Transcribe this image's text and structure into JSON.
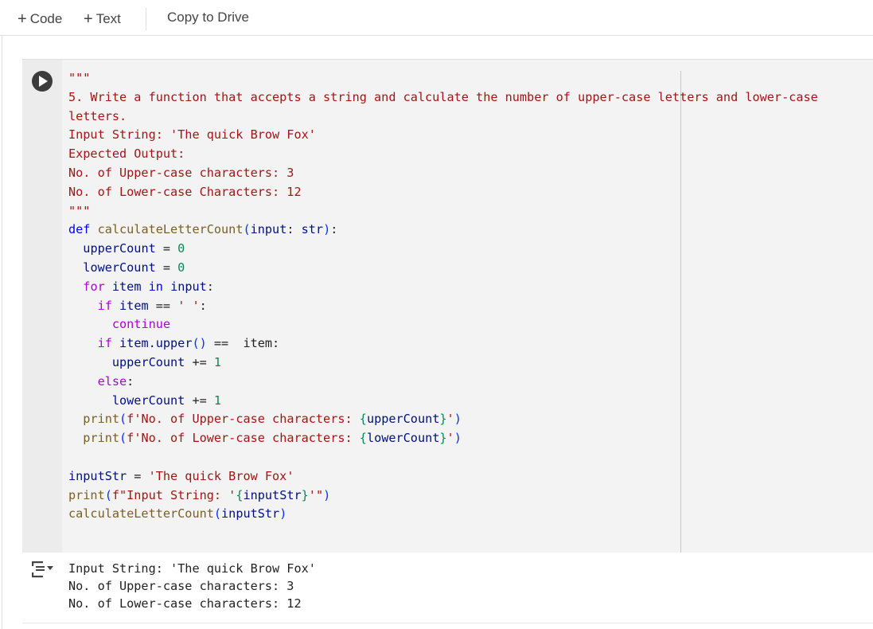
{
  "toolbar": {
    "code_label": "Code",
    "text_label": "Text",
    "copy_to_drive_label": "Copy to Drive"
  },
  "cell": {
    "docstring": [
      "\"\"\"",
      "5. Write a function that accepts a string and calculate the number of upper-case letters and lower-case",
      "letters.",
      "Input String: 'The quick Brow Fox'",
      "Expected Output:",
      "No. of Upper-case characters: 3",
      "No. of Lower-case Characters: 12",
      "\"\"\""
    ],
    "code": {
      "def_kw": "def",
      "fn_name": "calculateLetterCount",
      "lp": "(",
      "param": "input",
      "colon_type": ": ",
      "type": "str",
      "rp": ")",
      "def_end": ":",
      "upper_var": "upperCount",
      "assign": " = ",
      "zero": "0",
      "lower_var": "lowerCount",
      "for_kw": "for",
      "item": "item",
      "in_kw": "in",
      "input": "input",
      "colon": ":",
      "if_kw": "if",
      "eq": " == ",
      "space_str": "' '",
      "continue_kw": "continue",
      "item_upper": "item.upper",
      "call_parens": "()",
      "item_end": " item:",
      "plus_eq": " += ",
      "one": "1",
      "else_kw": "else",
      "print": "print",
      "fstr_upper_a": "f'No. of Upper-case characters: ",
      "lb": "{",
      "rb": "}",
      "fstr_end": "'",
      "fstr_lower_a": "f'No. of Lower-case characters: ",
      "input_var": "inputStr",
      "input_val": "'The quick Brow Fox'",
      "fstr_input_a": "f\"Input String: '",
      "fstr_input_end": "'\"",
      "call_name": "calculateLetterCount"
    }
  },
  "output": {
    "lines": [
      "Input String: 'The quick Brow Fox'",
      "No. of Upper-case characters: 3",
      "No. of Lower-case characters: 12"
    ]
  }
}
